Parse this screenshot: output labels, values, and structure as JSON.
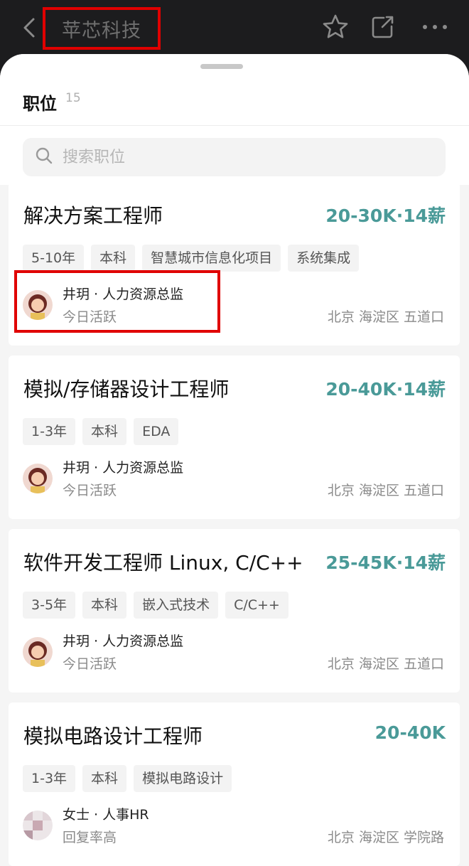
{
  "header": {
    "company_name": "苹芯科技",
    "icons": [
      "back-icon",
      "star-icon",
      "share-icon",
      "more-icon"
    ]
  },
  "positions": {
    "title": "职位",
    "count": "15"
  },
  "search": {
    "placeholder": "搜索职位"
  },
  "jobs": [
    {
      "title": "解决方案工程师",
      "salary": "20-30K·14薪",
      "tags": [
        "5-10年",
        "本科",
        "智慧城市信息化项目",
        "系统集成"
      ],
      "recruiter": "井玥 · 人力资源总监",
      "activity": "今日活跃",
      "location": "北京 海淀区 五道口"
    },
    {
      "title": "模拟/存储器设计工程师",
      "salary": "20-40K·14薪",
      "tags": [
        "1-3年",
        "本科",
        "EDA"
      ],
      "recruiter": "井玥 · 人力资源总监",
      "activity": "今日活跃",
      "location": "北京 海淀区 五道口"
    },
    {
      "title": "软件开发工程师 Linux, C/C++",
      "salary": "25-45K·14薪",
      "tags": [
        "3-5年",
        "本科",
        "嵌入式技术",
        "C/C++"
      ],
      "recruiter": "井玥 · 人力资源总监",
      "activity": "今日活跃",
      "location": "北京 海淀区 五道口"
    },
    {
      "title": "模拟电路设计工程师",
      "salary": "20-40K",
      "tags": [
        "1-3年",
        "本科",
        "模拟电路设计"
      ],
      "recruiter": "女士 · 人事HR",
      "activity": "回复率高",
      "location": "北京 海淀区 学院路"
    }
  ],
  "colors": {
    "accent": "#4a9a98",
    "highlight": "#e00000",
    "header_bg": "#1c1c1e"
  }
}
